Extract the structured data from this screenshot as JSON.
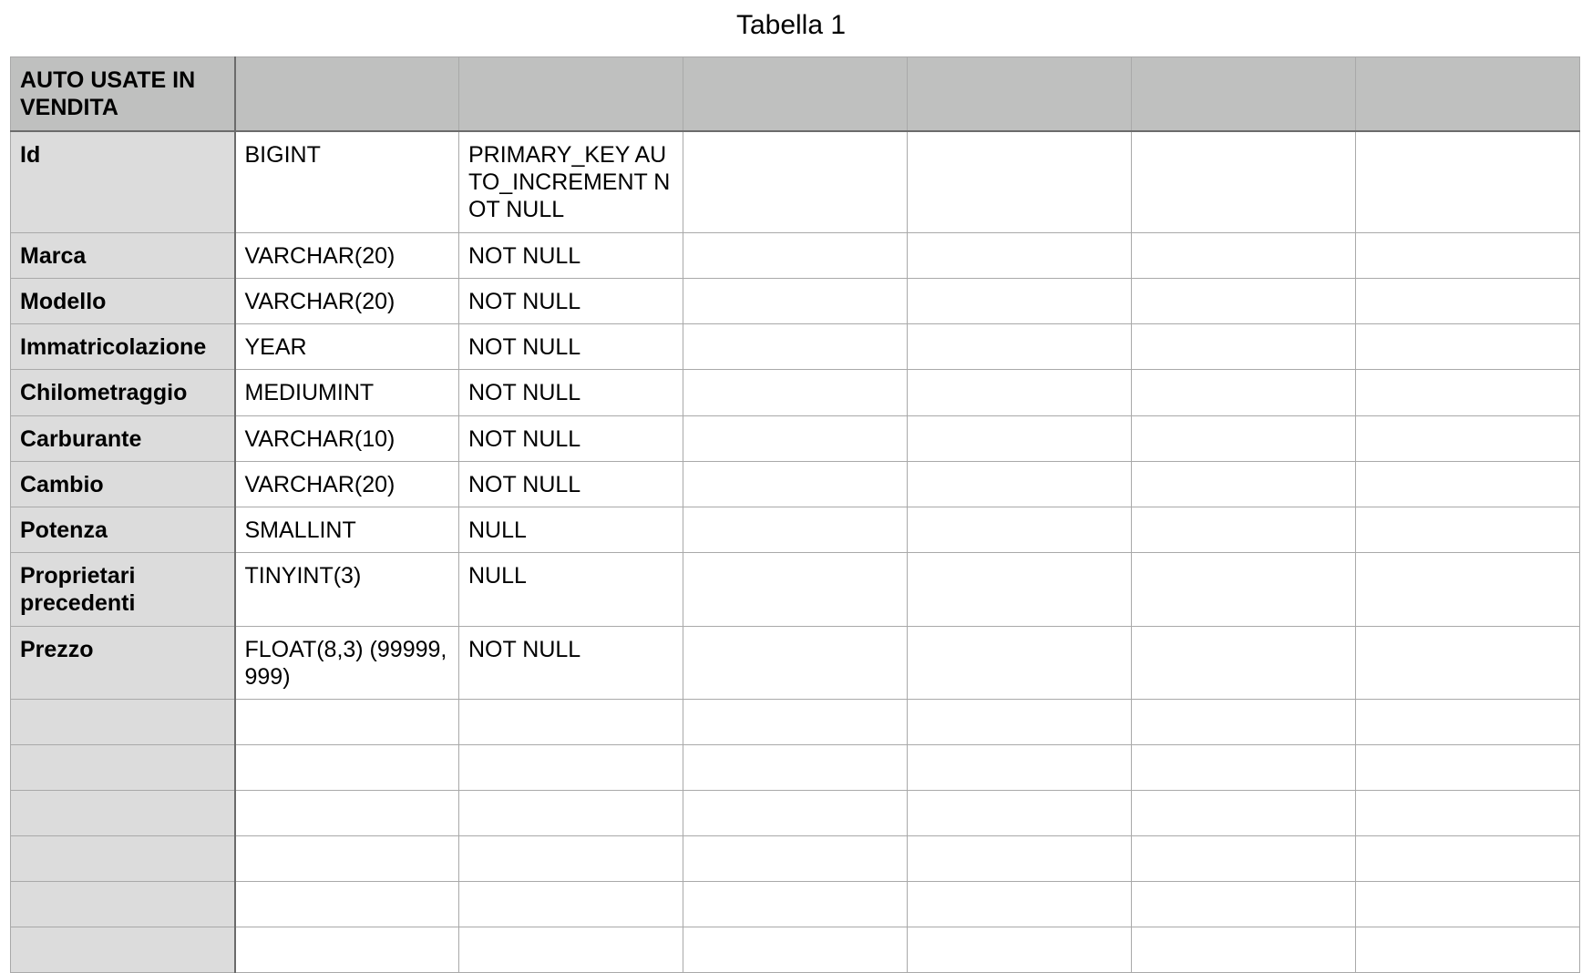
{
  "title": "Tabella 1",
  "table": {
    "header": "AUTO USATE IN VENDITA",
    "rows": [
      {
        "name": "Id",
        "type": "BIGINT",
        "constraint": "PRIMARY_KEY AUTO_INCREMENT NOT NULL"
      },
      {
        "name": "Marca",
        "type": "VARCHAR(20)",
        "constraint": "NOT NULL"
      },
      {
        "name": "Modello",
        "type": "VARCHAR(20)",
        "constraint": "NOT NULL"
      },
      {
        "name": "Immatricolazione",
        "type": "YEAR",
        "constraint": "NOT NULL"
      },
      {
        "name": "Chilometraggio",
        "type": "MEDIUMINT",
        "constraint": "NOT NULL"
      },
      {
        "name": "Carburante",
        "type": "VARCHAR(10)",
        "constraint": "NOT NULL"
      },
      {
        "name": "Cambio",
        "type": "VARCHAR(20)",
        "constraint": "NOT NULL"
      },
      {
        "name": "Potenza",
        "type": "SMALLINT",
        "constraint": "NULL"
      },
      {
        "name": "Proprietari precedenti",
        "type": "TINYINT(3)",
        "constraint": "NULL"
      },
      {
        "name": "Prezzo",
        "type": "FLOAT(8,3) (99999,999)",
        "constraint": "NOT NULL"
      }
    ]
  }
}
